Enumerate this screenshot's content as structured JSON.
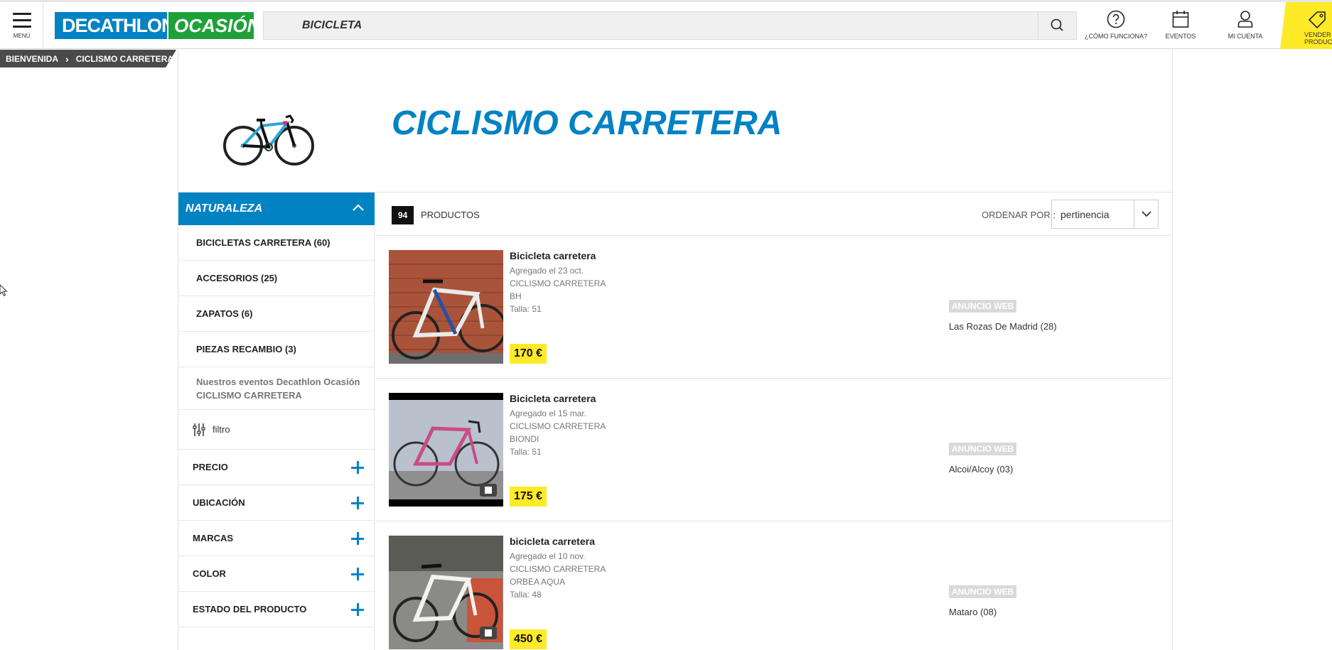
{
  "header": {
    "menu_label": "MENÚ",
    "logo_primary": "DECATHLON",
    "logo_secondary": "OCASIÓN",
    "search_value": "BICICLETA",
    "help_label": "¿CÓMO FUNCIONA?",
    "events_label": "EVENTOS",
    "account_label": "MI CUENTA",
    "sell_label_line1": "VENDER U",
    "sell_label_line2": "PRODUCT",
    "colors": {
      "brand_blue": "#0082c3",
      "brand_green": "#1fa13a",
      "sell_yellow": "#ffea28"
    }
  },
  "breadcrumb": {
    "items": [
      "BIENVENIDA",
      "CICLISMO CARRETERA"
    ]
  },
  "category": {
    "title": "CICLISMO CARRETERA"
  },
  "sidebar": {
    "header": "NATURALEZA",
    "categories": [
      {
        "label": "BICICLETAS CARRETERA (60)"
      },
      {
        "label": "ACCESORIOS (25)"
      },
      {
        "label": "ZAPATOS (6)"
      },
      {
        "label": "PIEZAS RECAMBIO (3)"
      }
    ],
    "events_line1": "Nuestros eventos Decathlon Ocasión",
    "events_line2": "CICLISMO CARRETERA",
    "filter_label": "filtro",
    "facets": [
      {
        "label": "PRECIO"
      },
      {
        "label": "UBICACIÓN"
      },
      {
        "label": "MARCAS"
      },
      {
        "label": "COLOR"
      },
      {
        "label": "ESTADO DEL PRODUCTO"
      }
    ]
  },
  "results": {
    "count": "94",
    "count_label": "PRODUCTOS",
    "sort_label": "ORDENAR POR :",
    "sort_value": "pertinencia",
    "listings": [
      {
        "title": "Bicicleta carretera",
        "added": "Agregado el 23 oct.",
        "category": "CICLISMO CARRETERA",
        "brand": "BH",
        "size": "Talla: 51",
        "price": "170 €",
        "badge": "ANUNCIO WEB",
        "location": "Las Rozas De Madrid (28)"
      },
      {
        "title": "Bicicleta carretera",
        "added": "Agregado el 15 mar.",
        "category": "CICLISMO CARRETERA",
        "brand": "BIONDI",
        "size": "Talla: 51",
        "price": "175 €",
        "badge": "ANUNCIO WEB",
        "location": "Alcoi/Alcoy (03)"
      },
      {
        "title": "bicicleta carretera",
        "added": "Agregado el 10 nov.",
        "category": "CICLISMO CARRETERA",
        "brand": "ORBEA AQUA",
        "size": "Talla: 48",
        "price": "450 €",
        "badge": "ANUNCIO WEB",
        "location": "Mataro (08)"
      }
    ]
  }
}
